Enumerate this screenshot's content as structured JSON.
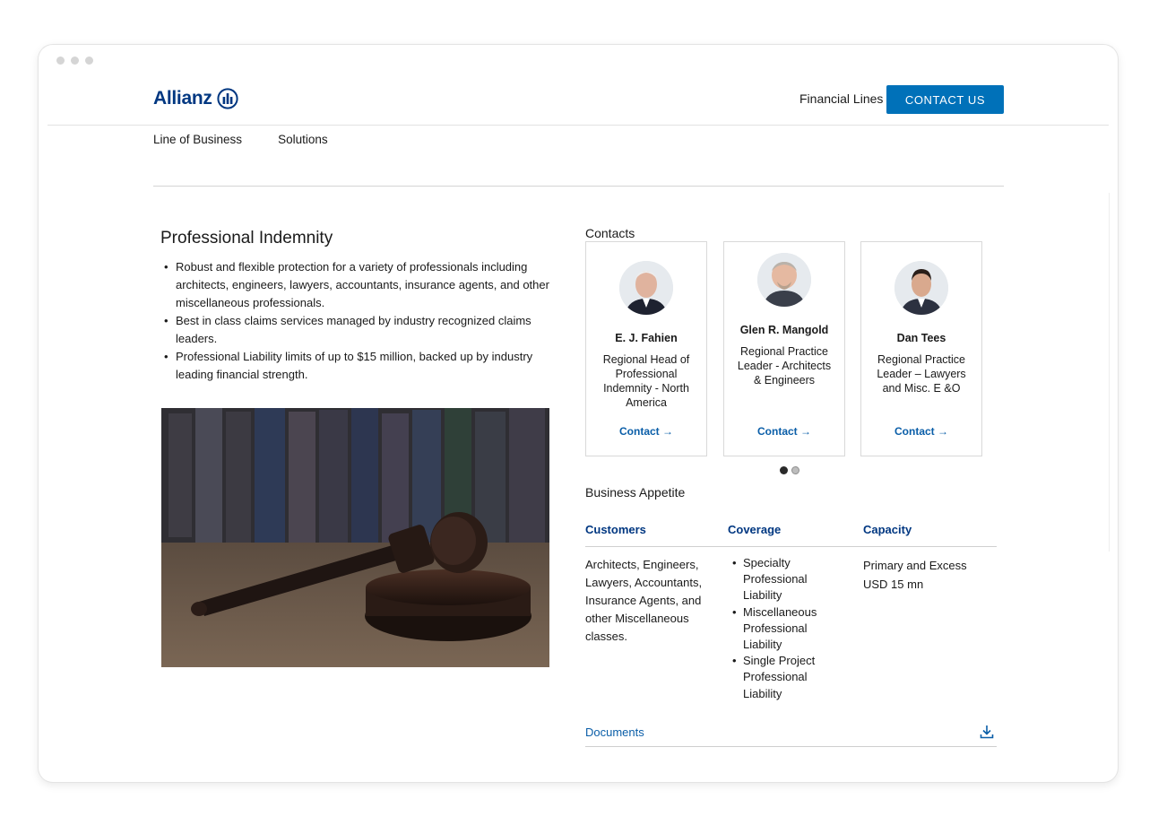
{
  "header": {
    "brand": "Allianz",
    "financial_lines": "Financial Lines",
    "contact_button": "CONTACT US"
  },
  "nav": {
    "items": [
      "Line of Business",
      "Solutions"
    ]
  },
  "product": {
    "title": "Professional Indemnity",
    "bullets": [
      "Robust and flexible protection for a variety of professionals including architects, engineers, lawyers, accountants, insurance agents, and other miscellaneous professionals.",
      "Best in class claims services managed by industry recognized claims leaders.",
      "Professional Liability limits of up to $15 million, backed up by industry leading financial strength."
    ]
  },
  "contacts": {
    "title": "Contacts",
    "cards": [
      {
        "name": "E. J. Fahien",
        "role": "Regional Head of Professional Indemnity - North America",
        "link": "Contact →"
      },
      {
        "name": "Glen R. Mangold",
        "role": "Regional Practice Leader - Architects & Engineers",
        "link": "Contact →"
      },
      {
        "name": "Dan Tees",
        "role": "Regional Practice Leader – Lawyers and Misc. E &O",
        "link": "Contact →"
      }
    ],
    "pager": {
      "active_page": 1,
      "total_pages": 2
    }
  },
  "appetite": {
    "title": "Business Appetite",
    "columns": [
      "Customers",
      "Coverage",
      "Capacity"
    ],
    "customers": "Architects, Engineers, Lawyers, Accountants, Insurance Agents, and other Miscellaneous classes.",
    "coverage": [
      "Specialty Professional Liability",
      "Miscellaneous Professional Liability",
      "Single Project Professional Liability"
    ],
    "capacity": "Primary and Excess USD 15 mn"
  },
  "documents": {
    "label": "Documents",
    "icon": "download-icon"
  },
  "colors": {
    "brand_navy": "#003781",
    "button_blue": "#0071b9",
    "link_blue": "#0a5ea8"
  }
}
